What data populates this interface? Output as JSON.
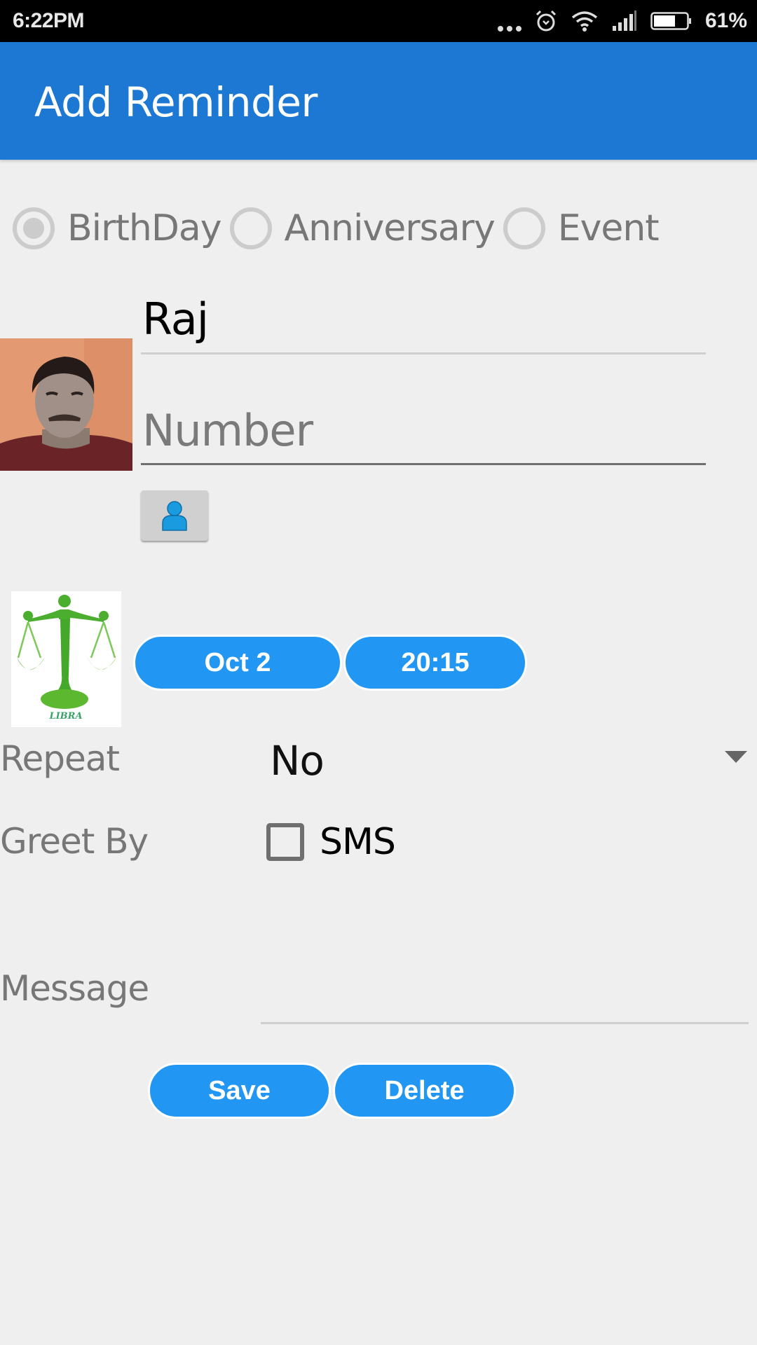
{
  "status_bar": {
    "time": "6:22PM",
    "battery_percent": "61%",
    "battery_level": 0.61,
    "icons": [
      "more-dots-icon",
      "alarm-icon",
      "wifi-icon",
      "signal-icon",
      "battery-icon"
    ]
  },
  "app_bar": {
    "title": "Add Reminder"
  },
  "reminder_type": {
    "options": [
      {
        "label": "BirthDay",
        "checked": true
      },
      {
        "label": "Anniversary",
        "checked": false
      },
      {
        "label": "Event",
        "checked": false
      }
    ]
  },
  "contact": {
    "name_value": "Raj",
    "number_value": "",
    "number_placeholder": "Number",
    "avatar_icon": "contact-photo",
    "pick_contact_icon": "person-icon"
  },
  "zodiac": {
    "sign": "LIBRA",
    "icon": "libra-scales-icon",
    "color": "#5cb82e"
  },
  "schedule": {
    "date_label": "Oct 2",
    "time_label": "20:15"
  },
  "repeat": {
    "label": "Repeat",
    "selected": "No"
  },
  "greet_by": {
    "label": "Greet By",
    "option_label": "SMS",
    "checked": false
  },
  "message": {
    "label": "Message",
    "value": ""
  },
  "actions": {
    "save_label": "Save",
    "delete_label": "Delete"
  },
  "colors": {
    "app_bar": "#1c78d2",
    "button": "#2196f3",
    "background": "#efefef"
  }
}
